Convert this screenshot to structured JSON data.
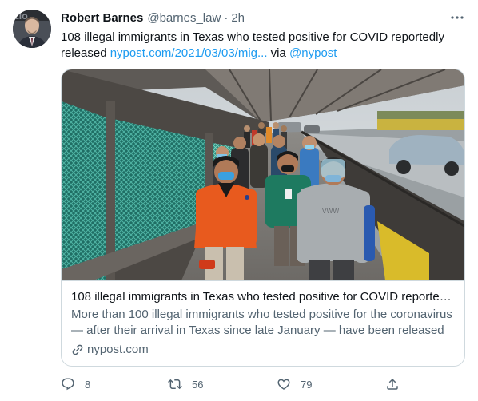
{
  "tweet": {
    "author": {
      "name": "Robert Barnes",
      "handle": "@barnes_law",
      "separator": "·",
      "time": "2h",
      "avatar_icon": "person-portrait-avatar"
    },
    "text": {
      "line": "108 illegal immigrants in Texas who tested positive for COVID reportedly released",
      "link": "nypost.com/2021/03/03/mig...",
      "via": "via",
      "mention": "@nypost"
    },
    "card": {
      "image_icon": "migrants-walking-on-bridge-photo",
      "title": "108 illegal immigrants in Texas who tested positive for COVID reportedly released",
      "description": "More than 100 illegal immigrants who tested positive for the coronavirus — after their arrival in Texas since late January — have been released",
      "domain": "nypost.com"
    },
    "actions": {
      "reply_count": "8",
      "retweet_count": "56",
      "like_count": "79"
    }
  },
  "colors": {
    "link": "#1d9bf0",
    "secondary_text": "#536471",
    "border": "#cfd9de"
  }
}
